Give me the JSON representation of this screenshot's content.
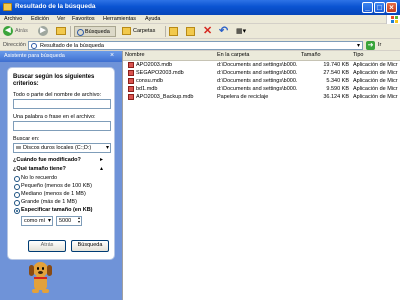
{
  "window": {
    "title": "Resultado de la búsqueda"
  },
  "titlebar_buttons": {
    "minimize": "_",
    "maximize": "□",
    "close": "×"
  },
  "menu": [
    "Archivo",
    "Edición",
    "Ver",
    "Favoritos",
    "Herramientas",
    "Ayuda"
  ],
  "toolbar": {
    "back": "Atrás",
    "search": "Búsqueda",
    "folders": "Carpetas",
    "views": "▦▾"
  },
  "address": {
    "label": "Dirección",
    "value": "Resultado de la búsqueda",
    "go": "Ir"
  },
  "pane": {
    "header": "Asistente para búsqueda",
    "heading": "Buscar según los siguientes criterios:",
    "name_label": "Todo o parte del nombre de archivo:",
    "name_value": "",
    "phrase_label": "Una palabra o frase en el archivo:",
    "phrase_value": "",
    "lookin_label": "Buscar en:",
    "lookin_value": "Discos duros locales (C:;D:)",
    "when_modified": "¿Cuándo fue modificado?",
    "what_size": "¿Qué tamaño tiene?",
    "size_options": [
      "No lo recuerdo",
      "Pequeño (menos de 100 KB)",
      "Mediano (menos de 1 MB)",
      "Grande (más de 1 MB)",
      "Especificar tamaño (en KB)"
    ],
    "selected_option": 4,
    "size_mode": "como mí",
    "size_value": "5000",
    "back_button": "Atrás",
    "search_button": "Búsqueda"
  },
  "columns": [
    "Nombre",
    "En la carpeta",
    "Tamaño",
    "Tipo"
  ],
  "files": [
    {
      "name": "APO2003.mdb",
      "folder": "d:\\Documents and settings\\b000...",
      "size": "19.740 KB",
      "type": "Aplicación de Micr"
    },
    {
      "name": "SEGAPO2003.mdb",
      "folder": "d:\\Documents and settings\\b000...",
      "size": "27.540 KB",
      "type": "Aplicación de Micr"
    },
    {
      "name": "consu.mdb",
      "folder": "d:\\Documents and settings\\b000...",
      "size": "5.340 KB",
      "type": "Aplicación de Micr"
    },
    {
      "name": "bd1.mdb",
      "folder": "d:\\Documents and settings\\b000...",
      "size": "9.590 KB",
      "type": "Aplicación de Micr"
    },
    {
      "name": "APO2003_Backup.mdb",
      "folder": "Papelera de reciclaje",
      "size": "36.124 KB",
      "type": "Aplicación de Micr"
    }
  ],
  "colors": {
    "title_blue": "#0a53d1",
    "pane_blue": "#6f93d8",
    "chrome": "#ece9d8",
    "file_icon": "#d9534f"
  }
}
